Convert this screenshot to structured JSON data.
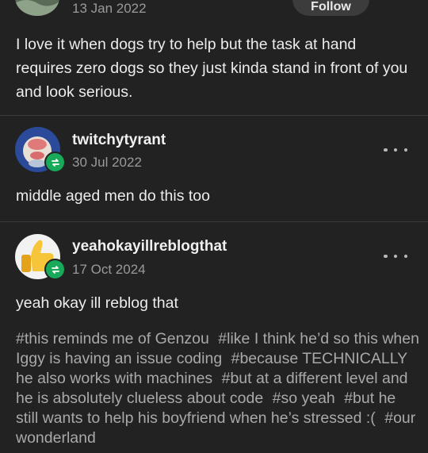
{
  "post_top": {
    "date": "13 Jan 2022",
    "follow_label": "Follow",
    "body": "I love it when dogs try to help but the task at hand requires zero dogs so they just kinda stand in front of you and look serious."
  },
  "reblogs": [
    {
      "username": "twitchytyrant",
      "date": "30 Jul 2022",
      "body": "middle aged men do this too"
    },
    {
      "username": "yeahokayillreblogthat",
      "date": "17 Oct 2024",
      "body": "yeah okay ill reblog that",
      "tags": [
        "#this reminds me of Genzou",
        "#like I think he’d so this when Iggy is having an issue coding",
        "#because TECHNICALLY he also works with machines",
        "#but at a different level and he is absolutely clueless about code",
        "#so yeah",
        "#but he still wants to help his boyfriend when he’s stressed :(",
        "#our wonderland"
      ]
    }
  ],
  "colors": {
    "background": "#222222",
    "text": "#ececec",
    "muted": "#9a9a9a",
    "tags": "#a9a9a9",
    "reblog_badge": "#19a95a"
  },
  "icons": {
    "reblog": "reblog-icon",
    "more": "more-options-icon"
  }
}
